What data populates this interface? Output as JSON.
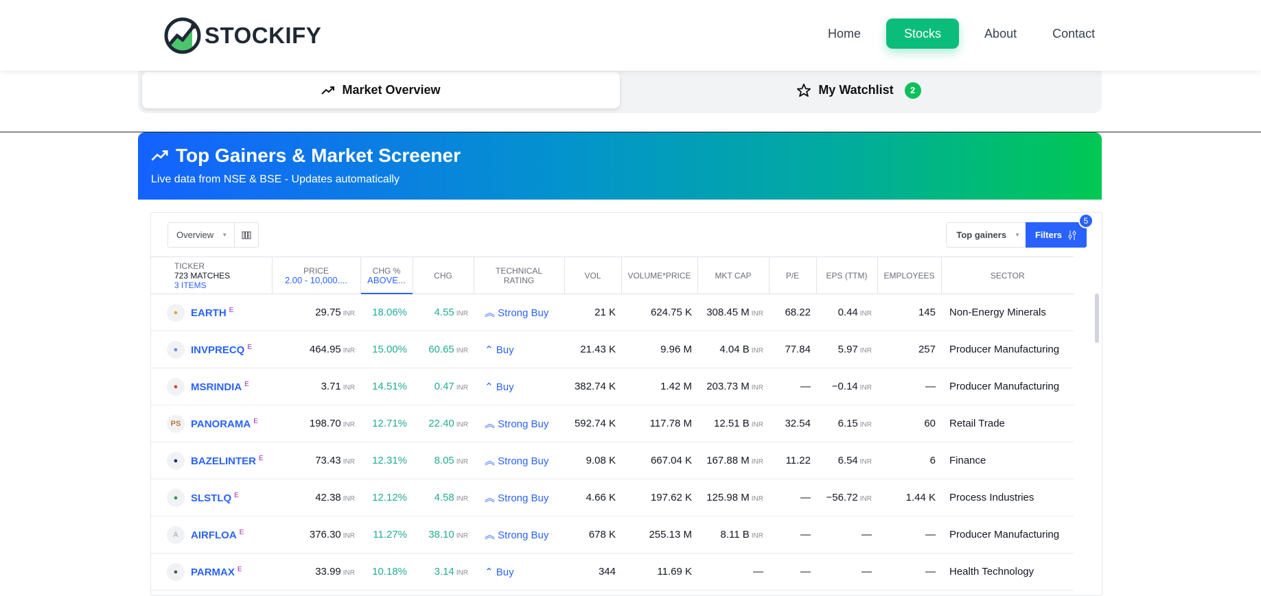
{
  "brand": {
    "name": "STOCKIFY"
  },
  "nav": {
    "items": [
      "Home",
      "Stocks",
      "About",
      "Contact"
    ],
    "active": "Stocks"
  },
  "tabs": {
    "market_overview": "Market Overview",
    "watchlist": "My Watchlist",
    "watchlist_count": "2"
  },
  "banner": {
    "title": "Top Gainers & Market Screener",
    "subtitle": "Live data from NSE & BSE - Updates automatically"
  },
  "toolbar": {
    "view": "Overview",
    "preset": "Top gainers",
    "filters": "Filters",
    "filter_count": "5"
  },
  "columns": {
    "ticker": "Ticker",
    "matches": "723 matches",
    "items": "3 items",
    "price": "Price",
    "price_filter": "2.00 - 10,000....",
    "chg_pct": "Chg %",
    "chg_pct_filter": "Above...",
    "chg": "Chg",
    "technical": "Technical Rating",
    "vol": "Vol",
    "vol_price": "Volume*Price",
    "mkt_cap": "Mkt Cap",
    "pe": "P/E",
    "eps": "EPS (TTM)",
    "employees": "Employees",
    "sector": "Sector"
  },
  "currency": "INR",
  "colors": {
    "accent": "#2962ff",
    "green": "#22ab94",
    "nav_active": "#0bbd7a"
  },
  "rows": [
    {
      "ticker": "EARTH",
      "logo": "",
      "price": "29.75",
      "chg_pct": "18.06%",
      "chg": "4.55",
      "rating": "Strong Buy",
      "vol": "21 K",
      "vol_price": "624.75 K",
      "mkt_cap": "308.45 M",
      "pe": "68.22",
      "eps": "0.44",
      "employees": "145",
      "sector": "Non-Energy Minerals"
    },
    {
      "ticker": "INVPRECQ",
      "logo": "",
      "price": "464.95",
      "chg_pct": "15.00%",
      "chg": "60.65",
      "rating": "Buy",
      "vol": "21.43 K",
      "vol_price": "9.96 M",
      "mkt_cap": "4.04 B",
      "pe": "77.84",
      "eps": "5.97",
      "employees": "257",
      "sector": "Producer Manufacturing"
    },
    {
      "ticker": "MSRINDIA",
      "logo": "",
      "price": "3.71",
      "chg_pct": "14.51%",
      "chg": "0.47",
      "rating": "Buy",
      "vol": "382.74 K",
      "vol_price": "1.42 M",
      "mkt_cap": "203.73 M",
      "pe": "—",
      "eps": "−0.14",
      "employees": "—",
      "sector": "Producer Manufacturing"
    },
    {
      "ticker": "PANORAMA",
      "logo": "PS",
      "price": "198.70",
      "chg_pct": "12.71%",
      "chg": "22.40",
      "rating": "Strong Buy",
      "vol": "592.74 K",
      "vol_price": "117.78 M",
      "mkt_cap": "12.51 B",
      "pe": "32.54",
      "eps": "6.15",
      "employees": "60",
      "sector": "Retail Trade"
    },
    {
      "ticker": "BAZELINTER",
      "logo": "",
      "price": "73.43",
      "chg_pct": "12.31%",
      "chg": "8.05",
      "rating": "Strong Buy",
      "vol": "9.08 K",
      "vol_price": "667.04 K",
      "mkt_cap": "167.88 M",
      "pe": "11.22",
      "eps": "6.54",
      "employees": "6",
      "sector": "Finance"
    },
    {
      "ticker": "SLSTLQ",
      "logo": "",
      "price": "42.38",
      "chg_pct": "12.12%",
      "chg": "4.58",
      "rating": "Strong Buy",
      "vol": "4.66 K",
      "vol_price": "197.62 K",
      "mkt_cap": "125.98 M",
      "pe": "—",
      "eps": "−56.72",
      "employees": "1.44 K",
      "sector": "Process Industries"
    },
    {
      "ticker": "AIRFLOA",
      "logo": "A",
      "price": "376.30",
      "chg_pct": "11.27%",
      "chg": "38.10",
      "rating": "Strong Buy",
      "vol": "678 K",
      "vol_price": "255.13 M",
      "mkt_cap": "8.11 B",
      "pe": "—",
      "eps": "—",
      "employees": "—",
      "sector": "Producer Manufacturing"
    },
    {
      "ticker": "PARMAX",
      "logo": "",
      "price": "33.99",
      "chg_pct": "10.18%",
      "chg": "3.14",
      "rating": "Buy",
      "vol": "344",
      "vol_price": "11.69 K",
      "mkt_cap": "—",
      "pe": "—",
      "eps": "—",
      "employees": "—",
      "sector": "Health Technology"
    }
  ]
}
